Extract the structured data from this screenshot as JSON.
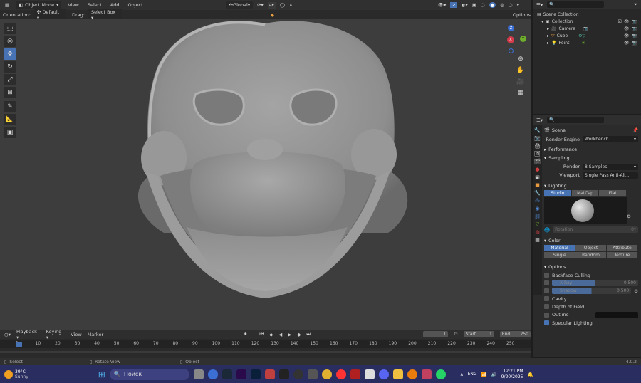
{
  "header": {
    "mode": "Object Mode",
    "menus": [
      "View",
      "Select",
      "Add",
      "Object"
    ],
    "transform": "Global",
    "options_label": "Options"
  },
  "view_header": {
    "orientation_label": "Orientation:",
    "orientation_value": "Default",
    "drag_label": "Drag:",
    "drag_value": "Select Box"
  },
  "gizmo": {
    "z": "Z",
    "x": "X",
    "y": "Y"
  },
  "outliner": {
    "root": "Scene Collection",
    "collection": "Collection",
    "items": [
      "Camera",
      "Cube",
      "Point"
    ]
  },
  "properties": {
    "scene_title": "Scene",
    "render_engine_label": "Render Engine",
    "render_engine_value": "Workbench",
    "performance": "Performance",
    "sampling": "Sampling",
    "render_label": "Render",
    "render_value": "8 Samples",
    "viewport_label": "Viewport",
    "viewport_value": "Single Pass Anti-Ali...",
    "lighting": "Lighting",
    "lighting_options": [
      "Studio",
      "MatCap",
      "Flat"
    ],
    "rotation_label": "Rotation",
    "rotation_value": "0°",
    "color": "Color",
    "color_options_row1": [
      "Material",
      "Object",
      "Attribute"
    ],
    "color_options_row2": [
      "Single",
      "Random",
      "Texture"
    ],
    "options": "Options",
    "backface_culling": "Backface Culling",
    "xray_label": "X-Ray",
    "xray_value": "0.500",
    "shadow_label": "Shadow",
    "shadow_value": "0.500",
    "cavity": "Cavity",
    "depth_of_field": "Depth of Field",
    "outline": "Outline",
    "specular_lighting": "Specular Lighting"
  },
  "timeline": {
    "menus": [
      "Playback",
      "Keying",
      "View",
      "Marker"
    ],
    "current_frame": "1",
    "start_label": "Start",
    "start_value": "1",
    "end_label": "End",
    "end_value": "250",
    "ticks": [
      "1",
      "10",
      "20",
      "30",
      "40",
      "50",
      "60",
      "70",
      "80",
      "90",
      "100",
      "110",
      "120",
      "130",
      "140",
      "150",
      "160",
      "170",
      "180",
      "190",
      "200",
      "210",
      "220",
      "230",
      "240",
      "250"
    ]
  },
  "statusbar": {
    "select": "Select",
    "rotate_view": "Rotate View",
    "object": "Object",
    "version": "4.0.2"
  },
  "taskbar": {
    "temperature": "39°C",
    "weather": "Sunny",
    "search_placeholder": "Поиск",
    "language": "ENG",
    "time": "12:21 PM",
    "date": "9/20/2025"
  },
  "colors": {
    "accent": "#4772b3",
    "viewport": "#3d3d3d",
    "taskbar": "#2a2d60"
  }
}
